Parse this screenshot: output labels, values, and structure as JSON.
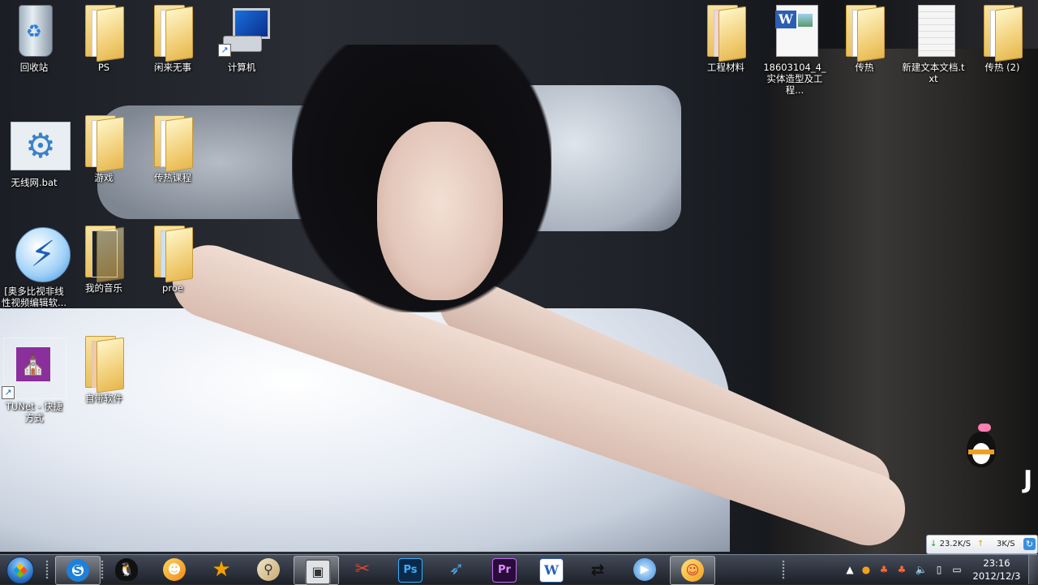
{
  "desktop": {
    "icons": [
      {
        "label": "回收站",
        "type": "recycle-bin"
      },
      {
        "label": "PS",
        "type": "folder"
      },
      {
        "label": "闲来无事",
        "type": "folder"
      },
      {
        "label": "计算机",
        "type": "computer"
      },
      {
        "label": "无线网.bat",
        "type": "batch-file"
      },
      {
        "label": "游戏",
        "type": "folder"
      },
      {
        "label": "传热课程",
        "type": "folder"
      },
      {
        "label": "[奥多比视非线性视频编辑软...",
        "type": "shortcut"
      },
      {
        "label": "我的音乐",
        "type": "folder"
      },
      {
        "label": "proe",
        "type": "folder"
      },
      {
        "label": "TUNet - 快捷方式",
        "type": "shortcut"
      },
      {
        "label": "自带软件",
        "type": "folder"
      },
      {
        "label": "工程材料",
        "type": "folder"
      },
      {
        "label": "18603104_4_实体造型及工程...",
        "type": "word-document"
      },
      {
        "label": "传热",
        "type": "folder"
      },
      {
        "label": "新建文本文档.txt",
        "type": "text-file"
      },
      {
        "label": "传热 (2)",
        "type": "folder"
      }
    ]
  },
  "netspeed": {
    "down": "23.2K/S",
    "up": "3K/S"
  },
  "taskbar": {
    "apps": [
      {
        "name": "sogou-input",
        "glyph": "S"
      },
      {
        "name": "qq",
        "glyph": "🐧"
      },
      {
        "name": "chat",
        "glyph": "☻"
      },
      {
        "name": "star-app",
        "glyph": "★"
      },
      {
        "name": "search-app",
        "glyph": "⚲"
      },
      {
        "name": "frame-app",
        "glyph": "▣"
      },
      {
        "name": "snipping-tool",
        "glyph": "✂"
      },
      {
        "name": "photoshop",
        "glyph": "Ps"
      },
      {
        "name": "bird-app",
        "glyph": "➶"
      },
      {
        "name": "premiere",
        "glyph": "Pr"
      },
      {
        "name": "word",
        "glyph": "W"
      },
      {
        "name": "transfer-app",
        "glyph": "⇄"
      },
      {
        "name": "media-player",
        "glyph": "▶"
      },
      {
        "name": "qq-chat",
        "glyph": "☺"
      }
    ],
    "clock": {
      "time": "23:16",
      "date": "2012/12/3"
    }
  },
  "colors": {
    "taskbar": "#1c2028",
    "folder": "#f2d07a",
    "accent": "#2f78c8"
  }
}
